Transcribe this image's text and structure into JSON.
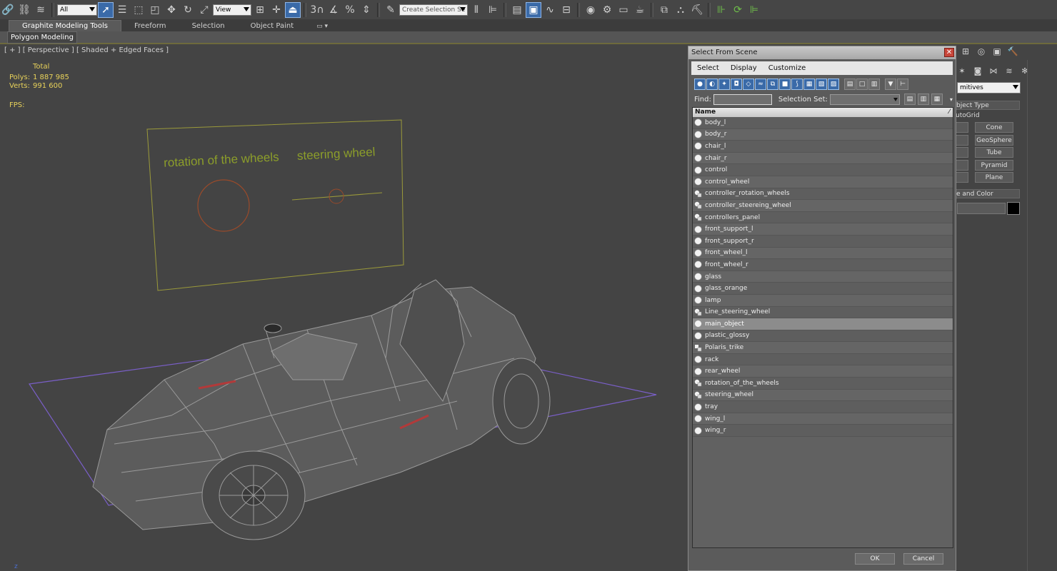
{
  "toolbar": {
    "filter_value": "All",
    "ref_coord_value": "View",
    "selection_set_placeholder": "Create Selection Se",
    "snap_label": "3",
    "percent_label": "%"
  },
  "ribbon": {
    "tabs": [
      {
        "label": "Graphite Modeling Tools",
        "active": true
      },
      {
        "label": "Freeform",
        "active": false
      },
      {
        "label": "Selection",
        "active": false
      },
      {
        "label": "Object Paint",
        "active": false
      }
    ],
    "panel_label": "Polygon Modeling"
  },
  "viewport": {
    "label": "[ + ] [ Perspective ] [ Shaded + Edged Faces ]",
    "stats": {
      "total_label": "Total",
      "polys_label": "Polys:",
      "polys_value": "1 887 985",
      "verts_label": "Verts:",
      "verts_value": "991 600",
      "fps_label": "FPS:"
    },
    "annotation_left": "rotation of the wheels",
    "annotation_right": "steering wheel",
    "axis_label": "z"
  },
  "command_panel": {
    "dropdown_value": "mitives",
    "object_type_header": "bject Type",
    "autogrid_label": "utoGrid",
    "buttons": [
      "Cone",
      "GeoSphere",
      "Tube",
      "Pyramid",
      "Plane"
    ],
    "name_color_header": "e and Color"
  },
  "dialog": {
    "title": "Select From Scene",
    "menu": [
      "Select",
      "Display",
      "Customize"
    ],
    "find_label": "Find:",
    "find_value": "",
    "selection_set_label": "Selection Set:",
    "column_name": "Name",
    "ok_label": "OK",
    "cancel_label": "Cancel",
    "items": [
      {
        "name": "body_l",
        "type": "geometry",
        "selected": false
      },
      {
        "name": "body_r",
        "type": "geometry",
        "selected": false
      },
      {
        "name": "chair_l",
        "type": "geometry",
        "selected": false
      },
      {
        "name": "chair_r",
        "type": "geometry",
        "selected": false
      },
      {
        "name": "control",
        "type": "geometry",
        "selected": false
      },
      {
        "name": "control_wheel",
        "type": "geometry",
        "selected": false
      },
      {
        "name": "controller_rotation_wheels",
        "type": "shape",
        "selected": false
      },
      {
        "name": "controller_steereing_wheel",
        "type": "shape",
        "selected": false
      },
      {
        "name": "controllers_panel",
        "type": "shape",
        "selected": false
      },
      {
        "name": "front_support_l",
        "type": "geometry",
        "selected": false
      },
      {
        "name": "front_support_r",
        "type": "geometry",
        "selected": false
      },
      {
        "name": "front_wheel_l",
        "type": "geometry",
        "selected": false
      },
      {
        "name": "front_wheel_r",
        "type": "geometry",
        "selected": false
      },
      {
        "name": "glass",
        "type": "geometry",
        "selected": false
      },
      {
        "name": "glass_orange",
        "type": "geometry",
        "selected": false
      },
      {
        "name": "lamp",
        "type": "geometry",
        "selected": false
      },
      {
        "name": "Line_steering_wheel",
        "type": "shape",
        "selected": false
      },
      {
        "name": "main_object",
        "type": "geometry",
        "selected": true
      },
      {
        "name": "plastic_glossy",
        "type": "geometry",
        "selected": false
      },
      {
        "name": "Polaris_trike",
        "type": "group",
        "selected": false
      },
      {
        "name": "rack",
        "type": "geometry",
        "selected": false
      },
      {
        "name": "rear_wheel",
        "type": "geometry",
        "selected": false
      },
      {
        "name": "rotation_of_the_wheels",
        "type": "shape",
        "selected": false
      },
      {
        "name": "steering_wheel",
        "type": "shape",
        "selected": false
      },
      {
        "name": "tray",
        "type": "geometry",
        "selected": false
      },
      {
        "name": "wing_l",
        "type": "geometry",
        "selected": false
      },
      {
        "name": "wing_r",
        "type": "geometry",
        "selected": false
      }
    ]
  },
  "colors": {
    "viewport_bg": "#444444",
    "stats_text": "#e8d25a",
    "annotation_text": "#8c9e2a",
    "annotation_frame": "#9b9a3a",
    "grid_plane": "#7a5fc8",
    "circle_shape": "#9a4a2a",
    "accent_blue": "#3a6aa8",
    "selected_row": "#8c8c8c"
  }
}
